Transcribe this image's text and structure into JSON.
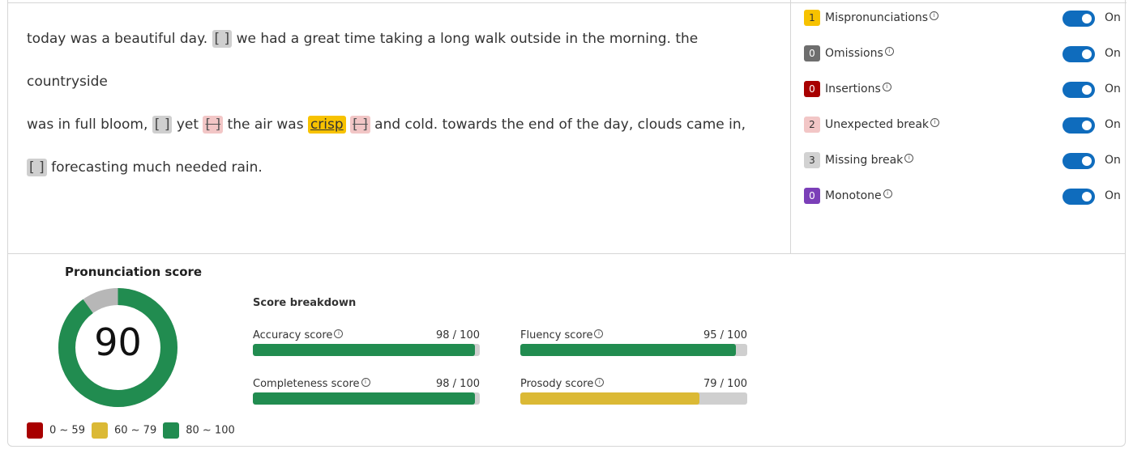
{
  "passage": {
    "w1": "today was a beautiful day.",
    "gap1": "[ ]",
    "w2": "we had a great time taking a long walk outside in the morning. the countryside",
    "w3": "was in full bloom,",
    "gap2": "[ ]",
    "w4": "yet",
    "unexp1": "[ ]",
    "w5": "the air was",
    "mispron1": "crisp",
    "unexp2": "[ ]",
    "w6": "and cold. towards the end of the day, clouds came in,",
    "gap3": "[ ]",
    "w7": "forecasting much needed rain."
  },
  "legend": [
    {
      "count": "1",
      "label": "Mispronunciations",
      "badge_bg": "#f7c200",
      "badge_fg": "#333333",
      "toggle": "On"
    },
    {
      "count": "0",
      "label": "Omissions",
      "badge_bg": "#6e6e6e",
      "badge_fg": "#ffffff",
      "toggle": "On"
    },
    {
      "count": "0",
      "label": "Insertions",
      "badge_bg": "#a80000",
      "badge_fg": "#ffffff",
      "toggle": "On"
    },
    {
      "count": "2",
      "label": "Unexpected break",
      "badge_bg": "#f2c6c6",
      "badge_fg": "#333333",
      "toggle": "On"
    },
    {
      "count": "3",
      "label": "Missing break",
      "badge_bg": "#d2d2d2",
      "badge_fg": "#333333",
      "toggle": "On"
    },
    {
      "count": "0",
      "label": "Monotone",
      "badge_bg": "#7b3fb8",
      "badge_fg": "#ffffff",
      "toggle": "On"
    }
  ],
  "score": {
    "title": "Pronunciation score",
    "value": "90",
    "fraction": 0.9,
    "color": "#218c50",
    "remainder_color": "#b7b7b7"
  },
  "scale": [
    {
      "label": "0 ~ 59",
      "color": "#a80000"
    },
    {
      "label": "60 ~ 79",
      "color": "#dbb935"
    },
    {
      "label": "80 ~ 100",
      "color": "#218c50"
    }
  ],
  "breakdown": {
    "title": "Score breakdown",
    "metrics": [
      {
        "label": "Accuracy score",
        "value": "98 / 100",
        "fraction": 0.98,
        "color": "#218c50"
      },
      {
        "label": "Fluency score",
        "value": "95 / 100",
        "fraction": 0.95,
        "color": "#218c50"
      },
      {
        "label": "Completeness score",
        "value": "98 / 100",
        "fraction": 0.98,
        "color": "#218c50"
      },
      {
        "label": "Prosody score",
        "value": "79 / 100",
        "fraction": 0.79,
        "color": "#dbb935"
      }
    ]
  },
  "icons": {
    "info": "info-icon"
  }
}
